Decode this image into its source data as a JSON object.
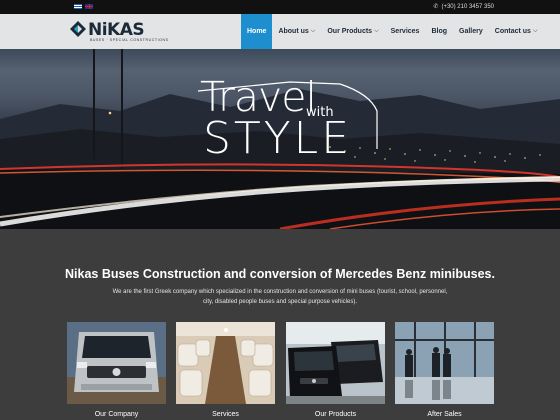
{
  "topbar": {
    "languages": [
      {
        "code": "el",
        "icon": "greek-flag-icon"
      },
      {
        "code": "en",
        "icon": "uk-flag-icon"
      }
    ],
    "phone": "(+30) 210 3457 350",
    "phone_icon": "phone-icon"
  },
  "brand": {
    "name": "NiKAS",
    "tagline": "BUSES · SPECIAL CONSTRUCTIONS",
    "colors": {
      "navy": "#1b2a38",
      "teal": "#2aa7c4"
    }
  },
  "nav": {
    "items": [
      {
        "label": "Home",
        "active": true,
        "dropdown": false
      },
      {
        "label": "About us",
        "active": false,
        "dropdown": true
      },
      {
        "label": "Our Products",
        "active": false,
        "dropdown": true
      },
      {
        "label": "Services",
        "active": false,
        "dropdown": false
      },
      {
        "label": "Blog",
        "active": false,
        "dropdown": false
      },
      {
        "label": "Gallery",
        "active": false,
        "dropdown": false
      },
      {
        "label": "Contact us",
        "active": false,
        "dropdown": true
      }
    ],
    "accent": "#1d8fcf"
  },
  "hero": {
    "line1": "Travel",
    "line2": "with",
    "line3": "STYLE"
  },
  "intro": {
    "title": "Nikas  Buses Construction and conversion of  Mercedes  Benz minibuses.",
    "text": "We are the first Greek company which specialized in the construction and conversion of mini buses (tourist, school, personnel, city, disabled people buses and special purpose vehicles)."
  },
  "cards": [
    {
      "label": "Our Company"
    },
    {
      "label": "Services"
    },
    {
      "label": "Our  Products"
    },
    {
      "label": "After Sales"
    }
  ]
}
